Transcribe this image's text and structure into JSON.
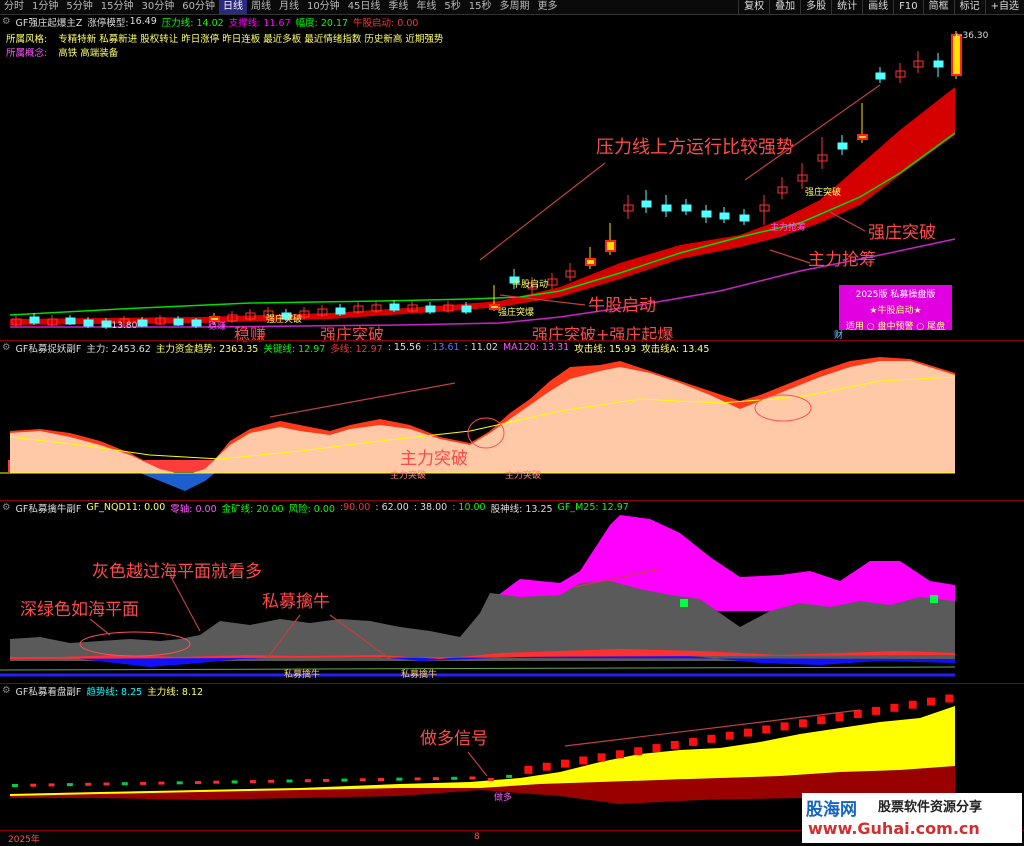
{
  "toolbar": {
    "periods": [
      "分时",
      "1分钟",
      "5分钟",
      "15分钟",
      "30分钟",
      "60分钟",
      "日线",
      "周线",
      "月线",
      "10分钟",
      "45日线",
      "季线",
      "年线",
      "5秒",
      "15秒",
      "多周期",
      "更多"
    ],
    "active": "日线",
    "right_tools": [
      "复权",
      "叠加",
      "多股",
      "统计",
      "画线",
      "F10",
      "简框",
      "标记",
      "+自选"
    ]
  },
  "main": {
    "indicator_name": "GF强庄起爆主Z",
    "model_label": "涨停模型:",
    "model_value": "16.49",
    "pressure": "压力线: 14.02",
    "support": "支撑线: 11.67",
    "amplitude": "幅度: 20.17",
    "bull_start": "牛股启动: 0.00",
    "style_label": "所属风格:",
    "style_value": "专精特新 私募新进 股权转让 昨日涨停 昨日连板 最近多板 最近情绪指数 历史新高 近期强势",
    "concept_label": "所属概念:",
    "concept_value": "高铁 高端装备",
    "high_price": "36.30",
    "low_price": "13.80",
    "tags": {
      "bull_start": "牛股启动",
      "breakout1": "强庄突破",
      "breakout2": "强庄突破",
      "burst1": "强庄突爆",
      "burst2": "强起爆",
      "force_chips": "主力抢筹",
      "stable": "稳赚",
      "cai": "财"
    },
    "annotations": {
      "pressure_strong": "压力线上方运行比较强势",
      "strong_breakout_right": "强庄突破",
      "main_force_grab": "主力抢筹",
      "bull_start": "牛股启动",
      "stable_profit": "稳赚",
      "strong_breakout_left": "强庄突破",
      "breakout_burst": "强庄突破+强庄起爆"
    },
    "badge": {
      "title": "2025版 私募操盘版",
      "star": "★牛股启动★",
      "footer": "适用 ○ 盘中预警 ○ 尾盘"
    }
  },
  "panel2": {
    "title": "GF私募捉妖副F",
    "main": "主力: 2453.62",
    "fund_trend": "主力资金趋势: 2363.35",
    "key_line": "关键线: 12.97",
    "long_line": "多线: 12.97",
    "v1": ": 15.56",
    "v2": ": 13.61",
    "v3": ": 11.02",
    "ma120": "MA120: 13.31",
    "attack": "攻击线: 15.93",
    "attack_a": "攻击线A: 13.45",
    "annotation": "主力突破",
    "tags": [
      "主力突破",
      "主力突破"
    ]
  },
  "panel3": {
    "title": "GF私募擒牛副F",
    "nqd": "GF_NQD11: 0.00",
    "zero_axis": "零轴: 0.00",
    "gold_line": "金矿线: 20.00",
    "risk": "风险: 0.00",
    "v90": ":90.00",
    "v62": ": 62.00",
    "v38": ": 38.00",
    "v10": ": 10.00",
    "stock_god": "股神线: 13.25",
    "m25": "GF_M25: 12.97",
    "ann_sea": "深绿色如海平面",
    "ann_gray": "灰色越过海平面就看多",
    "ann_catch": "私募擒牛",
    "tags": [
      "私募擒牛",
      "私募擒牛"
    ]
  },
  "panel4": {
    "title": "GF私募看盘副F",
    "trend": "趋势线: 8.25",
    "main": "主力线: 8.12",
    "annotation": "做多信号",
    "tag": "做多"
  },
  "footer": {
    "year": "2025年",
    "month": "8"
  },
  "watermark": {
    "logo": "股海网",
    "text": "股票软件资源分享",
    "url": "www.Guhai.com.cn"
  },
  "colors": {
    "up": "#ff3232",
    "down": "#00e5ff",
    "accent": "#ff4a4a",
    "yellow": "#ffff00",
    "magenta": "#ff00ff"
  }
}
